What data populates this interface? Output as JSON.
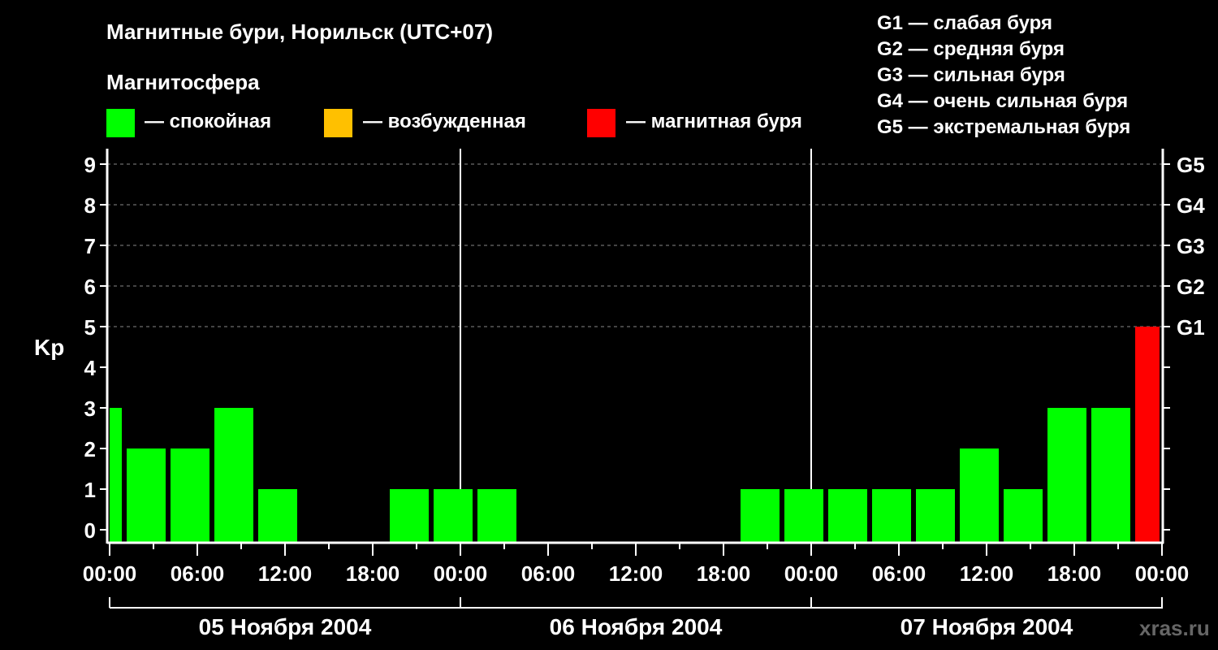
{
  "chart_data": {
    "type": "bar",
    "title": "Магнитные бури, Норильск (UTC+07)",
    "ylabel": "Kp",
    "ylim": [
      0,
      9
    ],
    "yticks": [
      "0",
      "1",
      "2",
      "3",
      "4",
      "5",
      "6",
      "7",
      "8",
      "9"
    ],
    "right_ticks": [
      {
        "kp": 5,
        "label": "G1"
      },
      {
        "kp": 6,
        "label": "G2"
      },
      {
        "kp": 7,
        "label": "G3"
      },
      {
        "kp": 8,
        "label": "G4"
      },
      {
        "kp": 9,
        "label": "G5"
      }
    ],
    "xtick_labels": [
      "00:00",
      "06:00",
      "12:00",
      "18:00",
      "00:00",
      "06:00",
      "12:00",
      "18:00",
      "00:00",
      "06:00",
      "12:00",
      "18:00",
      "00:00"
    ],
    "days": [
      "05 Ноября 2004",
      "06 Ноября 2004",
      "07 Ноября 2004"
    ],
    "bin_hours": 3,
    "first_bin_start_hour": -2,
    "values": [
      3,
      2,
      2,
      3,
      1,
      0,
      0,
      1,
      1,
      1,
      0,
      0,
      0,
      0,
      0,
      1,
      1,
      1,
      1,
      1,
      2,
      1,
      3,
      3,
      5
    ],
    "colors": {
      "quiet": "#00ff00",
      "active": "#ffc000",
      "storm": "#ff0000"
    },
    "grid": "dashed at G levels"
  },
  "legend": {
    "heading": "Магнитосфера",
    "items": [
      {
        "label": "— спокойная",
        "color": "#00ff00"
      },
      {
        "label": "— возбужденная",
        "color": "#ffc000"
      },
      {
        "label": "— магнитная буря",
        "color": "#ff0000"
      }
    ]
  },
  "g_scale": [
    "G1 — слабая буря",
    "G2 — средняя буря",
    "G3 — сильная буря",
    "G4 — очень сильная буря",
    "G5 — экстремальная буря"
  ],
  "watermark": "xras.ru"
}
